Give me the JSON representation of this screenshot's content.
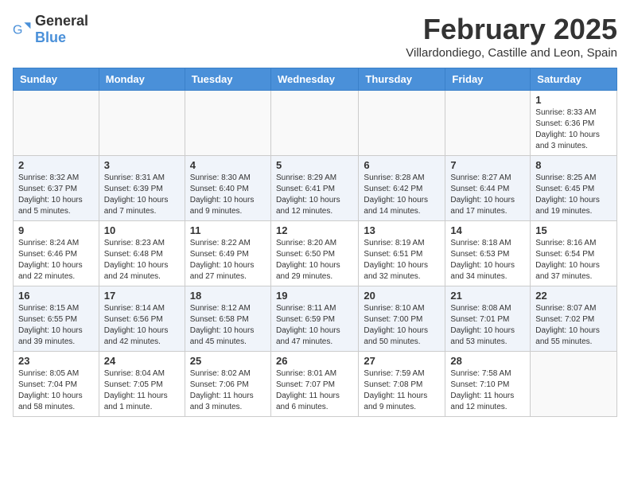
{
  "logo": {
    "general": "General",
    "blue": "Blue"
  },
  "title": "February 2025",
  "subtitle": "Villardondiego, Castille and Leon, Spain",
  "weekdays": [
    "Sunday",
    "Monday",
    "Tuesday",
    "Wednesday",
    "Thursday",
    "Friday",
    "Saturday"
  ],
  "weeks": [
    [
      {
        "day": "",
        "detail": ""
      },
      {
        "day": "",
        "detail": ""
      },
      {
        "day": "",
        "detail": ""
      },
      {
        "day": "",
        "detail": ""
      },
      {
        "day": "",
        "detail": ""
      },
      {
        "day": "",
        "detail": ""
      },
      {
        "day": "1",
        "detail": "Sunrise: 8:33 AM\nSunset: 6:36 PM\nDaylight: 10 hours and 3 minutes."
      }
    ],
    [
      {
        "day": "2",
        "detail": "Sunrise: 8:32 AM\nSunset: 6:37 PM\nDaylight: 10 hours and 5 minutes."
      },
      {
        "day": "3",
        "detail": "Sunrise: 8:31 AM\nSunset: 6:39 PM\nDaylight: 10 hours and 7 minutes."
      },
      {
        "day": "4",
        "detail": "Sunrise: 8:30 AM\nSunset: 6:40 PM\nDaylight: 10 hours and 9 minutes."
      },
      {
        "day": "5",
        "detail": "Sunrise: 8:29 AM\nSunset: 6:41 PM\nDaylight: 10 hours and 12 minutes."
      },
      {
        "day": "6",
        "detail": "Sunrise: 8:28 AM\nSunset: 6:42 PM\nDaylight: 10 hours and 14 minutes."
      },
      {
        "day": "7",
        "detail": "Sunrise: 8:27 AM\nSunset: 6:44 PM\nDaylight: 10 hours and 17 minutes."
      },
      {
        "day": "8",
        "detail": "Sunrise: 8:25 AM\nSunset: 6:45 PM\nDaylight: 10 hours and 19 minutes."
      }
    ],
    [
      {
        "day": "9",
        "detail": "Sunrise: 8:24 AM\nSunset: 6:46 PM\nDaylight: 10 hours and 22 minutes."
      },
      {
        "day": "10",
        "detail": "Sunrise: 8:23 AM\nSunset: 6:48 PM\nDaylight: 10 hours and 24 minutes."
      },
      {
        "day": "11",
        "detail": "Sunrise: 8:22 AM\nSunset: 6:49 PM\nDaylight: 10 hours and 27 minutes."
      },
      {
        "day": "12",
        "detail": "Sunrise: 8:20 AM\nSunset: 6:50 PM\nDaylight: 10 hours and 29 minutes."
      },
      {
        "day": "13",
        "detail": "Sunrise: 8:19 AM\nSunset: 6:51 PM\nDaylight: 10 hours and 32 minutes."
      },
      {
        "day": "14",
        "detail": "Sunrise: 8:18 AM\nSunset: 6:53 PM\nDaylight: 10 hours and 34 minutes."
      },
      {
        "day": "15",
        "detail": "Sunrise: 8:16 AM\nSunset: 6:54 PM\nDaylight: 10 hours and 37 minutes."
      }
    ],
    [
      {
        "day": "16",
        "detail": "Sunrise: 8:15 AM\nSunset: 6:55 PM\nDaylight: 10 hours and 39 minutes."
      },
      {
        "day": "17",
        "detail": "Sunrise: 8:14 AM\nSunset: 6:56 PM\nDaylight: 10 hours and 42 minutes."
      },
      {
        "day": "18",
        "detail": "Sunrise: 8:12 AM\nSunset: 6:58 PM\nDaylight: 10 hours and 45 minutes."
      },
      {
        "day": "19",
        "detail": "Sunrise: 8:11 AM\nSunset: 6:59 PM\nDaylight: 10 hours and 47 minutes."
      },
      {
        "day": "20",
        "detail": "Sunrise: 8:10 AM\nSunset: 7:00 PM\nDaylight: 10 hours and 50 minutes."
      },
      {
        "day": "21",
        "detail": "Sunrise: 8:08 AM\nSunset: 7:01 PM\nDaylight: 10 hours and 53 minutes."
      },
      {
        "day": "22",
        "detail": "Sunrise: 8:07 AM\nSunset: 7:02 PM\nDaylight: 10 hours and 55 minutes."
      }
    ],
    [
      {
        "day": "23",
        "detail": "Sunrise: 8:05 AM\nSunset: 7:04 PM\nDaylight: 10 hours and 58 minutes."
      },
      {
        "day": "24",
        "detail": "Sunrise: 8:04 AM\nSunset: 7:05 PM\nDaylight: 11 hours and 1 minute."
      },
      {
        "day": "25",
        "detail": "Sunrise: 8:02 AM\nSunset: 7:06 PM\nDaylight: 11 hours and 3 minutes."
      },
      {
        "day": "26",
        "detail": "Sunrise: 8:01 AM\nSunset: 7:07 PM\nDaylight: 11 hours and 6 minutes."
      },
      {
        "day": "27",
        "detail": "Sunrise: 7:59 AM\nSunset: 7:08 PM\nDaylight: 11 hours and 9 minutes."
      },
      {
        "day": "28",
        "detail": "Sunrise: 7:58 AM\nSunset: 7:10 PM\nDaylight: 11 hours and 12 minutes."
      },
      {
        "day": "",
        "detail": ""
      }
    ]
  ]
}
